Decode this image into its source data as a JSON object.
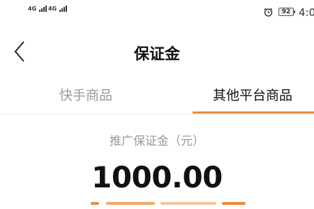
{
  "status_bar": {
    "network_1": "4G",
    "network_2": "4G",
    "alarm_icon": "alarm-clock-icon",
    "battery_level": "92",
    "time": "4:0"
  },
  "nav": {
    "back_icon": "chevron-left-icon",
    "title": "保证金"
  },
  "tabs": [
    {
      "label": "快手商品",
      "active": false
    },
    {
      "label": "其他平台商品",
      "active": true
    }
  ],
  "deposit": {
    "label": "推广保证金（元）",
    "amount": "1000.00"
  },
  "colors": {
    "accent": "#E8893A",
    "muted_text": "#999999",
    "primary_text": "#111111"
  }
}
